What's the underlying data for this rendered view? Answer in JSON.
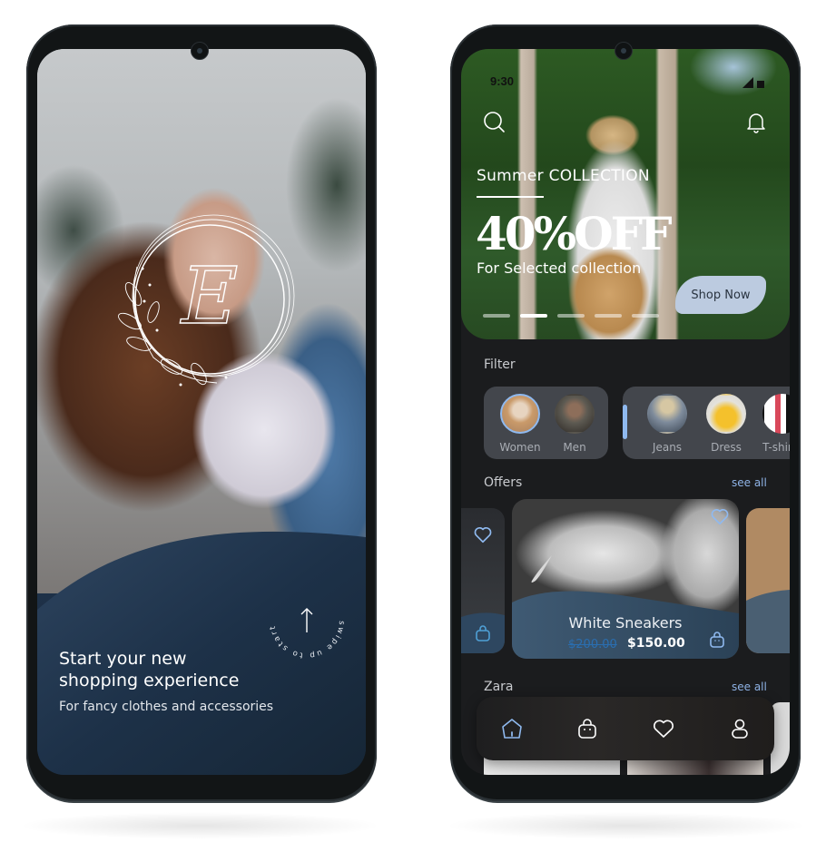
{
  "left_screen": {
    "brand_letter": "E",
    "swipe_text": "swipe up to start shopping",
    "headline_line1": "Start your new",
    "headline_line2": "shopping experience",
    "subtitle": "For fancy clothes and accessories"
  },
  "right_screen": {
    "status_bar": {
      "time": "9:30"
    },
    "hero": {
      "kicker": "Summer COLLECTION",
      "discount": "40%OFF",
      "subtitle": "For Selected collection",
      "cta_label": "Shop Now",
      "carousel": {
        "count": 5,
        "active_index": 1
      }
    },
    "filter": {
      "label": "Filter",
      "genders": [
        {
          "label": "Women",
          "selected": true
        },
        {
          "label": "Men",
          "selected": false
        }
      ],
      "categories": [
        {
          "label": "Jeans"
        },
        {
          "label": "Dress"
        },
        {
          "label": "T-shirts"
        }
      ]
    },
    "offers": {
      "label": "Offers",
      "see_all": "see all",
      "featured": {
        "title": "White Sneakers",
        "old_price": "$200.00",
        "new_price": "$150.00"
      }
    },
    "zara": {
      "label": "Zara",
      "see_all": "see all"
    },
    "bottom_nav": [
      {
        "icon": "home-icon",
        "active": true
      },
      {
        "icon": "bag-icon",
        "active": false
      },
      {
        "icon": "heart-icon",
        "active": false
      },
      {
        "icon": "profile-icon",
        "active": false
      }
    ]
  },
  "colors": {
    "accent": "#8fb9ef",
    "screen_bg": "#1b1c1e",
    "card_wave": "#3f5a73",
    "cta_bg": "#bccbe0",
    "old_price": "#2a6eb0"
  }
}
